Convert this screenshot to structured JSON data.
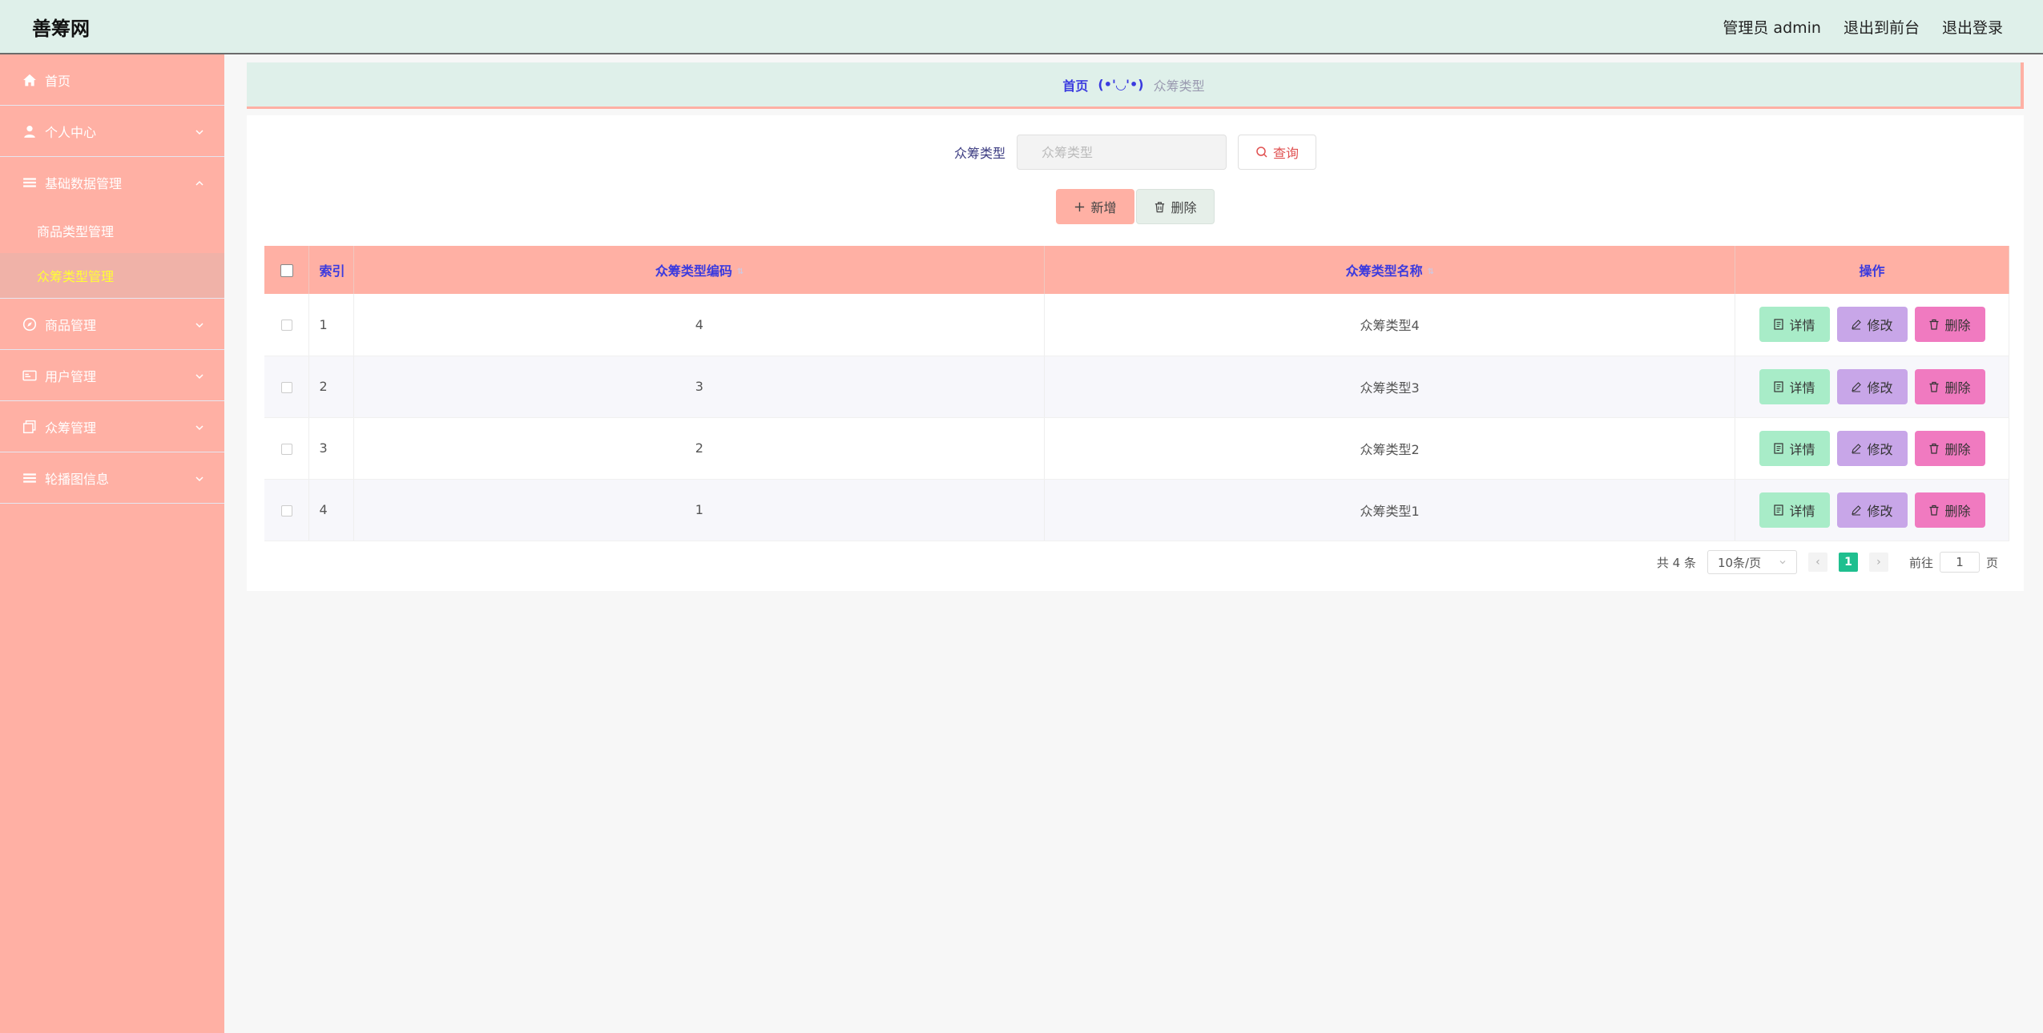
{
  "header": {
    "brand": "善筹网",
    "admin_label": "管理员 admin",
    "front_link": "退出到前台",
    "logout_link": "退出登录"
  },
  "sidebar": {
    "items": [
      {
        "label": "首页",
        "icon": "home-icon"
      },
      {
        "label": "个人中心",
        "icon": "user-icon"
      },
      {
        "label": "基础数据管理",
        "icon": "list-icon",
        "expanded": true,
        "children": [
          {
            "label": "商品类型管理"
          },
          {
            "label": "众筹类型管理",
            "active": true
          }
        ]
      },
      {
        "label": "商品管理",
        "icon": "compass-icon"
      },
      {
        "label": "用户管理",
        "icon": "id-card-icon"
      },
      {
        "label": "众筹管理",
        "icon": "copy-icon"
      },
      {
        "label": "轮播图信息",
        "icon": "list-icon"
      }
    ]
  },
  "breadcrumb": {
    "home": "首页",
    "separator": "(•'◡'•)",
    "current": "众筹类型"
  },
  "search": {
    "label": "众筹类型",
    "placeholder": "众筹类型",
    "query_button": "查询"
  },
  "actions": {
    "add": "新增",
    "delete": "删除"
  },
  "table": {
    "headers": {
      "index": "索引",
      "code": "众筹类型编码",
      "name": "众筹类型名称",
      "ops": "操作"
    },
    "rows": [
      {
        "index": "1",
        "code": "4",
        "name": "众筹类型4"
      },
      {
        "index": "2",
        "code": "3",
        "name": "众筹类型3"
      },
      {
        "index": "3",
        "code": "2",
        "name": "众筹类型2"
      },
      {
        "index": "4",
        "code": "1",
        "name": "众筹类型1"
      }
    ],
    "op_labels": {
      "detail": "详情",
      "edit": "修改",
      "delete": "删除"
    }
  },
  "pagination": {
    "total": "共 4 条",
    "page_size": "10条/页",
    "current_page": "1",
    "goto_prefix": "前往",
    "goto_value": "1",
    "goto_suffix": "页"
  },
  "colors": {
    "header_bg": "#dff0ea",
    "sidebar_bg": "#ffb0a4",
    "accent_text": "#3a3adf",
    "active_submenu_text": "#ffff33",
    "detail_btn": "#a8ecc8",
    "edit_btn": "#c8a6e8",
    "delete_btn": "#f07ac0",
    "page_active": "#1fbf8f"
  }
}
